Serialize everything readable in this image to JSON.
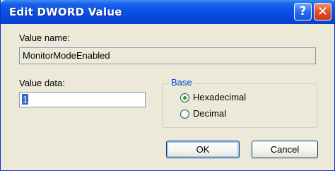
{
  "window": {
    "title": "Edit DWORD Value",
    "help_glyph": "?",
    "close_glyph": "✕"
  },
  "value_name": {
    "label": "Value name:",
    "value": "MonitorModeEnabled"
  },
  "value_data": {
    "label": "Value data:",
    "value": "1"
  },
  "base": {
    "legend": "Base",
    "options": [
      {
        "label": "Hexadecimal",
        "selected": true
      },
      {
        "label": "Decimal",
        "selected": false
      }
    ]
  },
  "buttons": {
    "ok_label": "OK",
    "cancel_label": "Cancel"
  },
  "colors": {
    "titlebar": "#0a52e8",
    "dialog_bg": "#ece9d8",
    "group_legend": "#0046d5",
    "radio_selected": "#21a121",
    "close_button": "#e0522a"
  }
}
